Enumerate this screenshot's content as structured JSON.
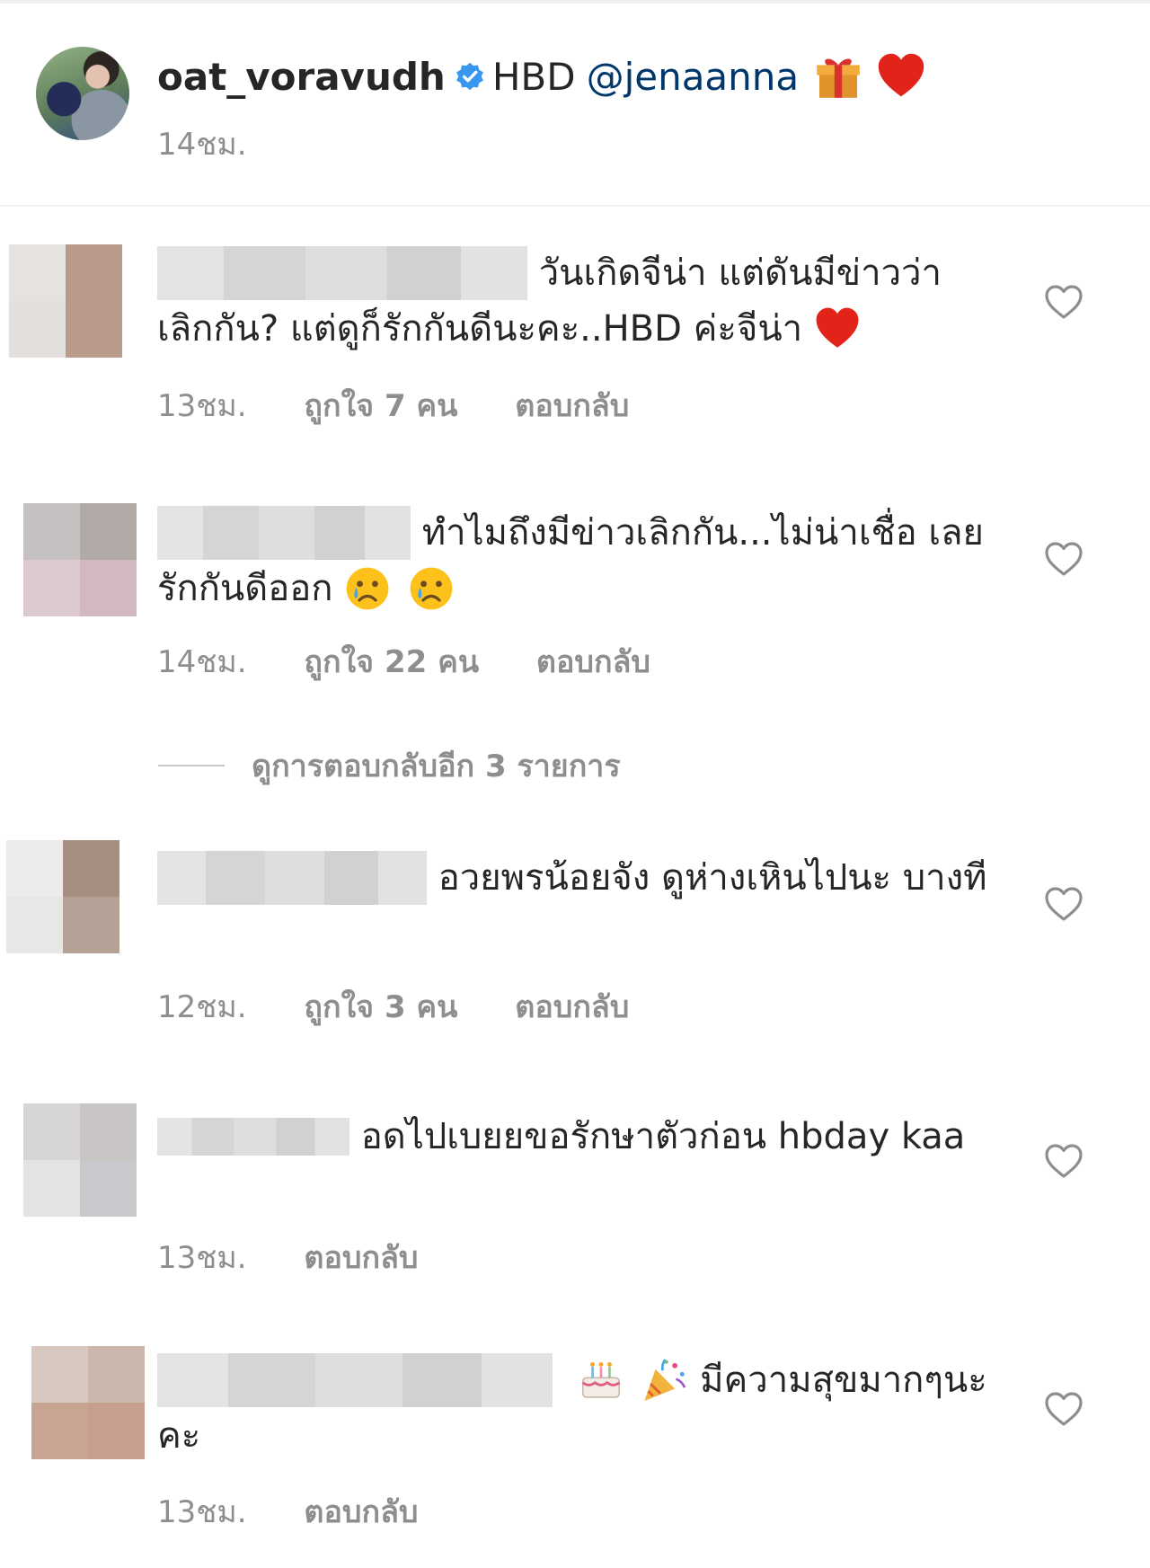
{
  "post": {
    "username": "oat_voravudh",
    "caption": "HBD",
    "mention": "@jenaanna",
    "time": "14ชม.",
    "icons": [
      "verified-badge-icon",
      "gift-emoji-icon",
      "red-heart-emoji-icon"
    ]
  },
  "comments": [
    {
      "text": "วันเกิดจีน่า แต่ดันมีข่าวว่า เลิกกัน? แต่ดูก็รักกันดีนะคะ..HBD ค่ะจีน่า",
      "time": "13ชม.",
      "likes": "ถูกใจ 7 คน",
      "reply": "ตอบกลับ",
      "avatar_colors": [
        "#e6e2df",
        "#b89a8a",
        "#e2dfdc",
        "#b99b8b"
      ]
    },
    {
      "text": "ทำไมถึงมีข่าวเลิกกัน...ไม่น่าเชื่อ เลย รักกันดีออก",
      "time": "14ชม.",
      "likes": "ถูกใจ 22 คน",
      "reply": "ตอบกลับ",
      "avatar_colors": [
        "#c4c1c0",
        "#b1aaa7",
        "#dcc9ce",
        "#d1b9bf"
      ]
    },
    {
      "text": "อวยพรน้อยจัง ดูห่างเหินไปนะ บางที",
      "time": "12ชม.",
      "likes": "ถูกใจ 3 คน",
      "reply": "ตอบกลับ",
      "avatar_colors": [
        "#ecebea",
        "#a78e82",
        "#e8e7e6",
        "#b5a196"
      ]
    },
    {
      "text": "อดไปเบยยขอรักษาตัวก่อน hbday kaa",
      "time": "13ชม.",
      "reply": "ตอบกลับ",
      "avatar_colors": [
        "#d7d5d5",
        "#c8c5c4",
        "#e3e3e4",
        "#c9c9cd"
      ]
    },
    {
      "text": "มีความสุขมากๆนะ คะ",
      "time": "13ชม.",
      "reply": "ตอบกลับ",
      "avatar_colors": [
        "#d9c8bf",
        "#ccb7ad",
        "#c8a493",
        "#c79f8f"
      ]
    }
  ],
  "view_replies": "ดูการตอบกลับอีก 3 รายการ",
  "colors": {
    "text": "#262626",
    "secondary": "#8e8e8e",
    "mention": "#00376b",
    "verified": "#3897f0",
    "divider": "#efefef"
  }
}
